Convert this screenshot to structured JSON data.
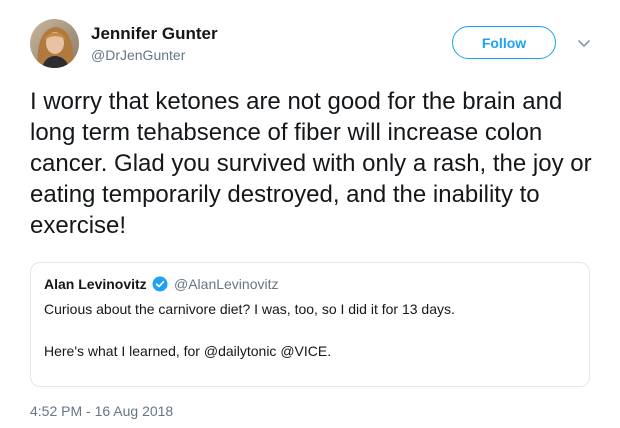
{
  "author": {
    "name": "Jennifer Gunter",
    "handle": "@DrJenGunter",
    "avatar_icon": "profile-photo"
  },
  "follow_button": {
    "label": "Follow",
    "color": "#1da1f2"
  },
  "menu": {
    "icon": "chevron-down-icon"
  },
  "tweet": {
    "text": "I worry that ketones are not good for the brain and long term tehabsence of fiber will increase colon cancer. Glad you survived with only a rash, the joy or eating temporarily destroyed, and the inability to exercise!",
    "timestamp": "4:52 PM - 16 Aug 2018"
  },
  "quoted_tweet": {
    "author_name": "Alan Levinovitz",
    "verified": true,
    "verified_icon": "verified-badge-icon",
    "author_handle": "@AlanLevinovitz",
    "line1": "Curious about the carnivore diet? I was, too, so I did it for 13 days.",
    "line2": "Here's what I learned, for @dailytonic @VICE."
  },
  "colors": {
    "text": "#14171a",
    "secondary_text": "#657786",
    "accent": "#1da1f2",
    "border": "#e1e8ed"
  }
}
